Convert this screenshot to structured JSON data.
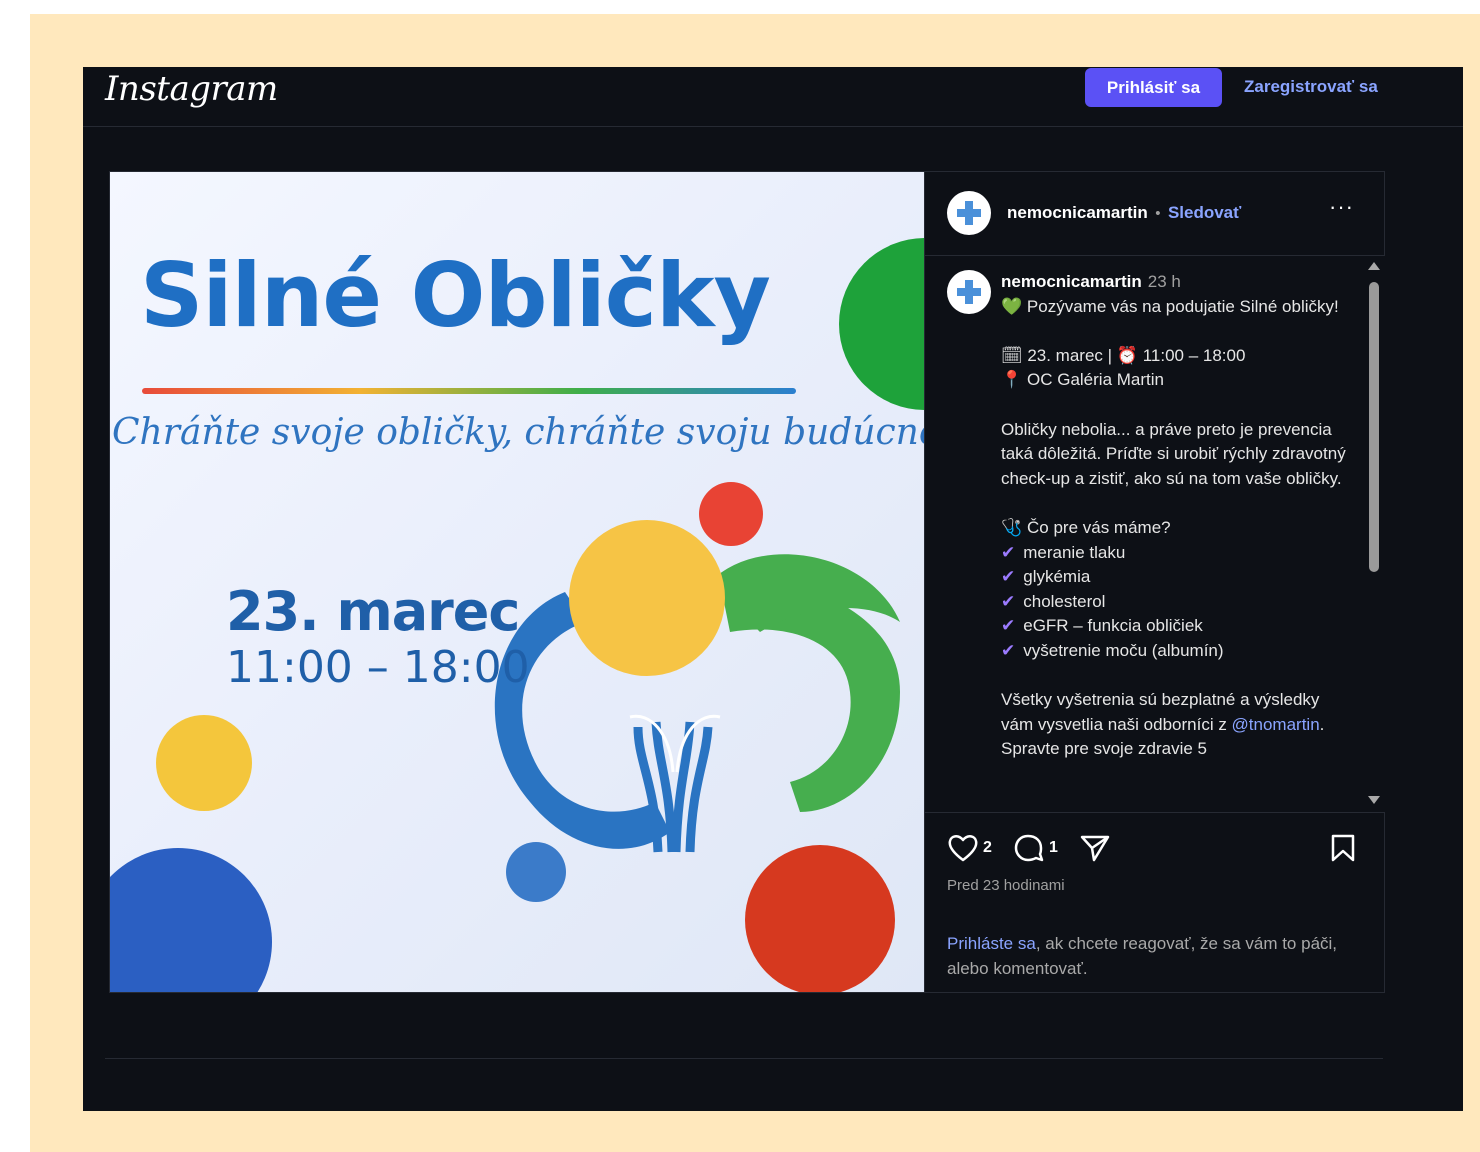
{
  "header": {
    "logo": "Instagram",
    "login_button": "Prihlásiť sa",
    "register_link": "Zaregistrovať sa"
  },
  "post_image": {
    "headline": "Silné Obličky",
    "tagline": "Chráňte svoje obličky, chráňte svoju budúcnosť",
    "date": "23. marec",
    "time": "11:00 – 18:00"
  },
  "post_header": {
    "username": "nemocnicamartin",
    "separator": "•",
    "follow": "Sledovať",
    "more": "···"
  },
  "caption": {
    "username": "nemocnicamartin",
    "time_ago": "23 h",
    "intro_emoji": "💚",
    "intro": "Pozývame vás na podujatie Silné obličky!",
    "date_emoji": "🗓",
    "date_line": "23. marec |",
    "clock_emoji": "⏰",
    "time_line": "11:00 – 18:00",
    "pin_emoji": "📍",
    "place": "OC Galéria Martin",
    "paragraph1": "Obličky nebolia... a práve preto je prevencia taká dôležitá. Príďte si urobiť rýchly zdravotný check-up a zistiť, ako sú na tom vaše obličky.",
    "list_emoji": "🩺",
    "list_title": "Čo pre vás máme?",
    "checklist": [
      "meranie tlaku",
      "glykémia",
      "cholesterol",
      "eGFR – funkcia obličiek",
      "vyšetrenie moču (albumín)"
    ],
    "check_mark": "✔",
    "paragraph2_start": "Všetky vyšetrenia sú bezplatné a výsledky vám vysvetlia naši odborníci z ",
    "mention": "@tnomartin",
    "paragraph2_end": ". Spravte pre svoje zdravie 5"
  },
  "actions": {
    "likes": "2",
    "comments": "1",
    "posted": "Pred 23 hodinami",
    "login_link": "Prihláste sa",
    "login_note": ", ak chcete reagovať, že sa vám to páči, alebo komentovať."
  },
  "colors": {
    "accent": "#5b51f5",
    "link": "#8aa4ff",
    "background": "#0d1016",
    "frame": "#ffe8bd",
    "brand_blue": "#1f6fc4"
  }
}
